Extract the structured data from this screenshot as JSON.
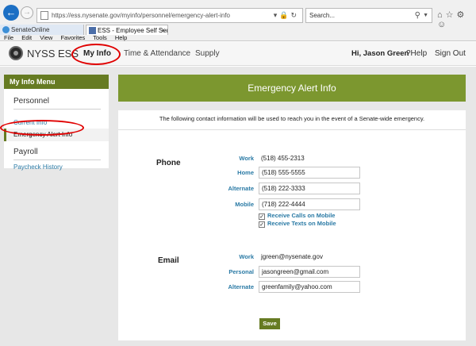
{
  "browser": {
    "url": "https://ess.nysenate.gov/myinfo/personnel/emergency-alert-info",
    "search_placeholder": "Search...",
    "tabs": [
      {
        "label": "SenateOnline"
      },
      {
        "label": "ESS - Employee Self Service"
      }
    ],
    "menu": [
      "File",
      "Edit",
      "View",
      "Favorites",
      "Tools",
      "Help"
    ]
  },
  "header": {
    "brand": "NYSS ESS",
    "nav": [
      "My Info",
      "Time & Attendance",
      "Supply"
    ],
    "greeting": "Hi, Jason Green",
    "help": "?Help",
    "signout": "Sign Out"
  },
  "sidebar": {
    "title": "My Info Menu",
    "personnel": "Personnel",
    "current_info": "Current Info",
    "emergency": "Emergency Alert Info",
    "payroll": "Payroll",
    "paycheck": "Paycheck History"
  },
  "main": {
    "title": "Emergency Alert Info",
    "intro": "The following contact information will be used to reach you in the event of a Senate-wide emergency.",
    "phone": {
      "title": "Phone",
      "work_label": "Work",
      "work_value": "(518) 455-2313",
      "home_label": "Home",
      "home_value": "(518) 555-5555",
      "alternate_label": "Alternate",
      "alternate_value": "(518) 222-3333",
      "mobile_label": "Mobile",
      "mobile_value": "(718) 222-4444",
      "calls_label": "Receive Calls on Mobile",
      "texts_label": "Receive Texts on Mobile"
    },
    "email": {
      "title": "Email",
      "work_label": "Work",
      "work_value": "jgreen@nysenate.gov",
      "personal_label": "Personal",
      "personal_value": "jasongreen@gmail.com",
      "alternate_label": "Alternate",
      "alternate_value": "greenfamily@yahoo.com"
    },
    "save": "Save"
  },
  "colors": {
    "accent_green": "#7c972f",
    "sidebar_green": "#667b22",
    "link_blue": "#2a7aa5",
    "annotation_red": "#e00000"
  }
}
